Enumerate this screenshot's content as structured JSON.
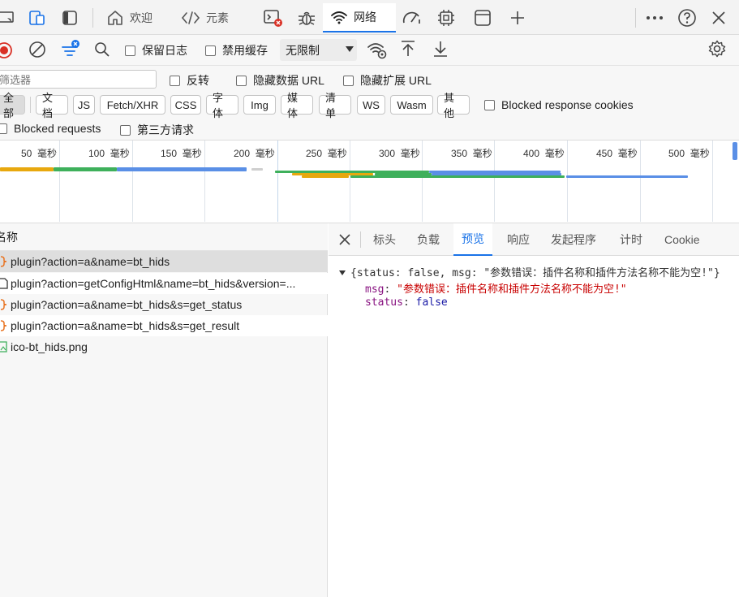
{
  "toolbar": {
    "tabs": {
      "welcome": "欢迎",
      "elements": "元素",
      "network": "网络"
    },
    "icons": [
      "device-emulation-icon",
      "inspect-icon",
      "dock-sidebar-icon",
      "home-icon",
      "code-icon",
      "console-error-icon",
      "bug-icon",
      "wifi-icon",
      "performance-icon",
      "cpu-icon",
      "application-icon",
      "add-tab-icon",
      "more-icon",
      "help-icon",
      "close-icon"
    ]
  },
  "network_bar": {
    "preserve_log": "保留日志",
    "disable_cache": "禁用缓存",
    "throttle": "无限制"
  },
  "filter_bar": {
    "placeholder": "筛选器",
    "invert": "反转",
    "hide_data_url": "隐藏数据 URL",
    "hide_ext_url": "隐藏扩展 URL",
    "types": [
      "全部",
      "文档",
      "JS",
      "Fetch/XHR",
      "CSS",
      "字体",
      "Img",
      "媒体",
      "清单",
      "WS",
      "Wasm",
      "其他"
    ],
    "blocked_cookies": "Blocked response cookies",
    "blocked_requests": "Blocked requests",
    "third_party": "第三方请求"
  },
  "timeline": {
    "unit": "毫秒",
    "ticks": [
      "50",
      "100",
      "150",
      "200",
      "250",
      "300",
      "350",
      "400",
      "450",
      "500"
    ]
  },
  "list": {
    "header": "名称",
    "rows": [
      {
        "name": "plugin?action=a&name=bt_hids",
        "type": "xhr"
      },
      {
        "name": "plugin?action=getConfigHtml&name=bt_hids&version=...",
        "type": "doc"
      },
      {
        "name": "plugin?action=a&name=bt_hids&s=get_status",
        "type": "xhr"
      },
      {
        "name": "plugin?action=a&name=bt_hids&s=get_result",
        "type": "xhr"
      },
      {
        "name": "ico-bt_hids.png",
        "type": "img"
      }
    ]
  },
  "detail": {
    "tabs": [
      "标头",
      "负载",
      "预览",
      "响应",
      "发起程序",
      "计时",
      "Cookie"
    ],
    "active_tab": "预览",
    "preview": {
      "summary": "{status: false, msg: \"参数错误：插件名称和插件方法名称不能为空!\"}",
      "msg_key": "msg",
      "msg_value": "\"参数错误：插件名称和插件方法名称不能为空!\"",
      "status_key": "status",
      "status_value": "false"
    }
  }
}
